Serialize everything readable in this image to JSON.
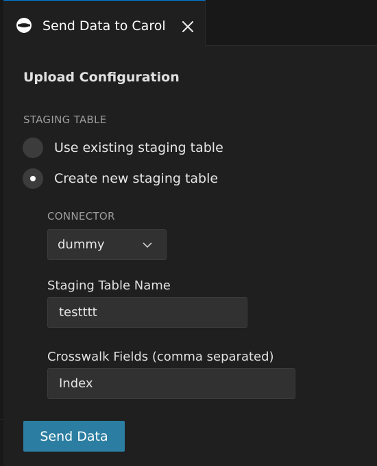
{
  "tab": {
    "title": "Send Data to Carol",
    "icon": "carol-logo-icon",
    "close_icon": "close-icon"
  },
  "form": {
    "title": "Upload Configuration",
    "staging_table_label": "STAGING TABLE",
    "radio_options": [
      {
        "label": "Use existing staging table",
        "checked": false
      },
      {
        "label": "Create new staging table",
        "checked": true
      }
    ],
    "connector_label": "CONNECTOR",
    "connector_value": "dummy",
    "staging_table_name_label": "Staging Table Name",
    "staging_table_name_value": "testttt",
    "crosswalk_label": "Crosswalk Fields (comma separated)",
    "crosswalk_value": "Index",
    "send_button_label": "Send Data"
  },
  "colors": {
    "accent": "#0078d4",
    "button": "#2b7ea1",
    "background": "#1f1f1f",
    "input_background": "#313131"
  }
}
